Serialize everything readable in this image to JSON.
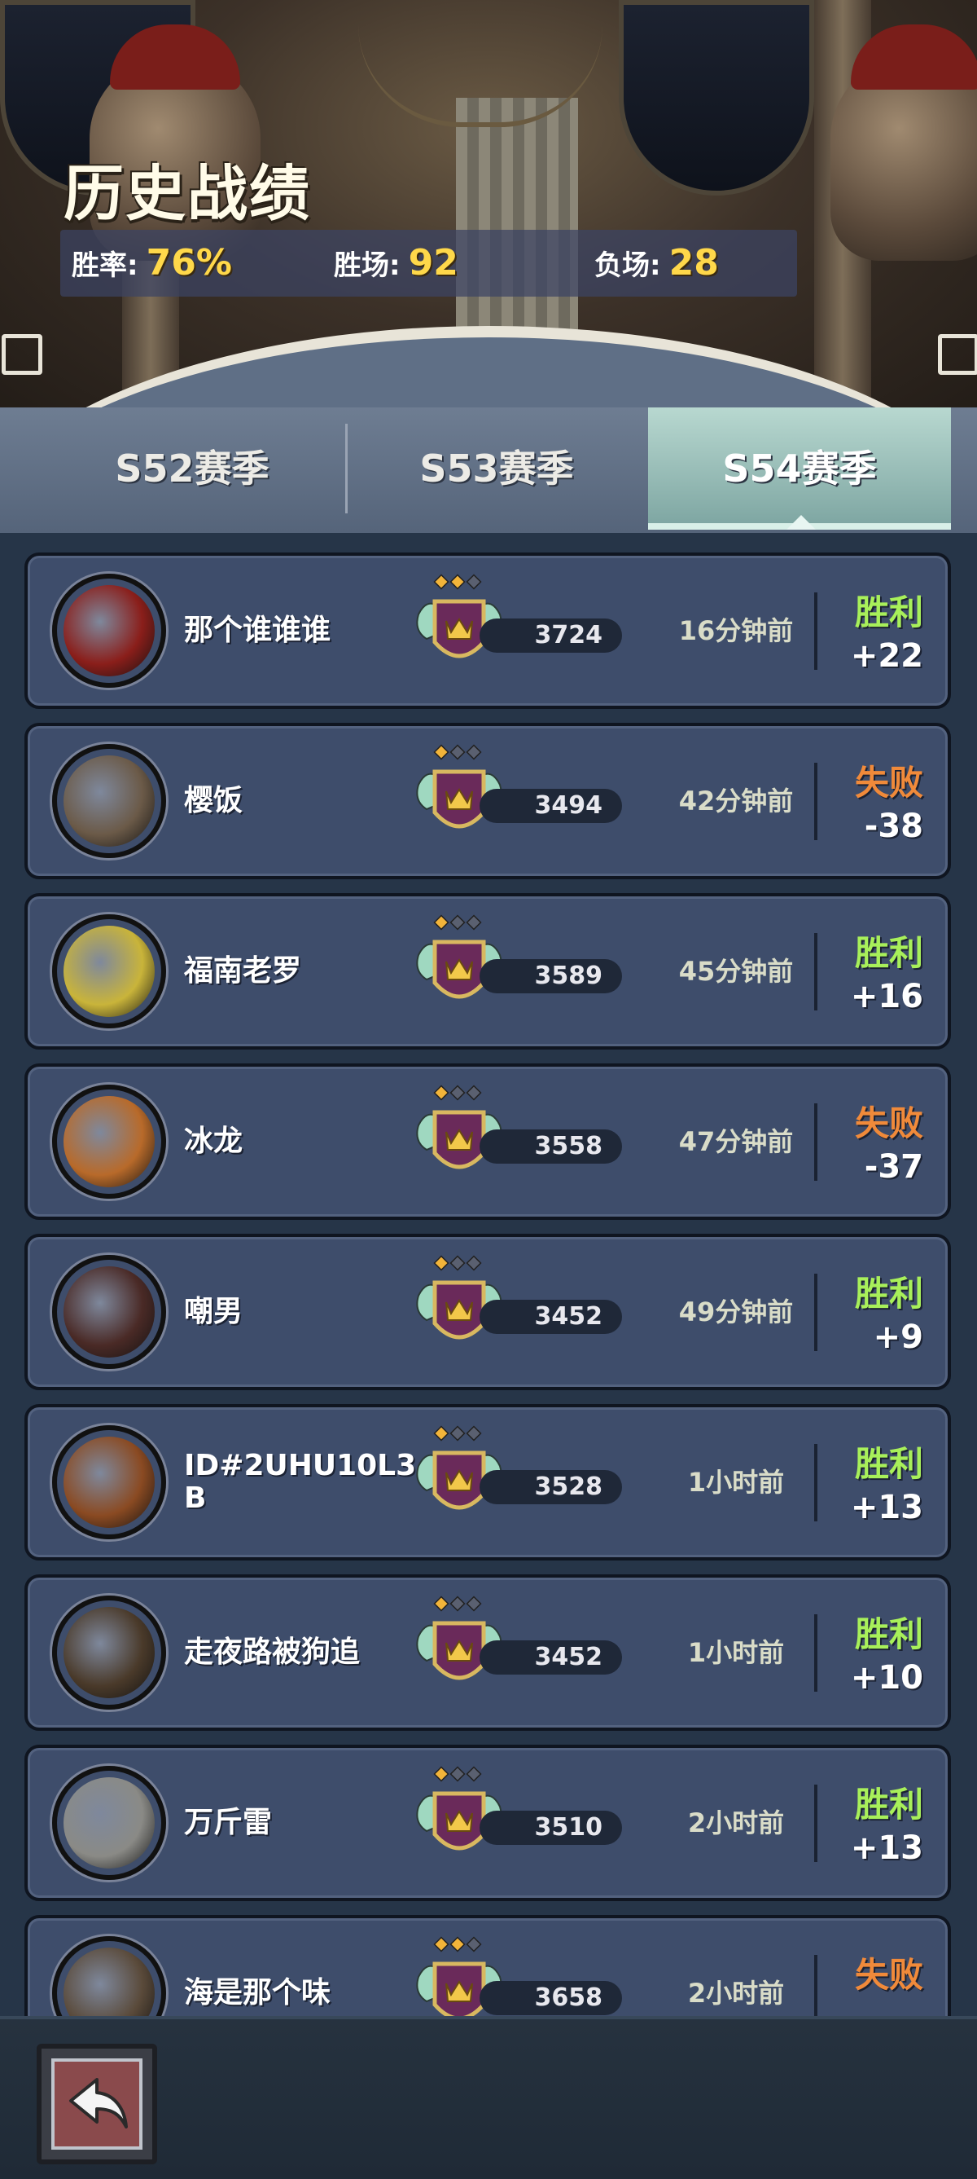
{
  "header": {
    "title": "历史战绩",
    "win_rate_label": "胜率:",
    "win_rate_value": "76%",
    "wins_label": "胜场:",
    "wins_value": "92",
    "losses_label": "负场:",
    "losses_value": "28"
  },
  "tabs": [
    {
      "label": "S52赛季",
      "active": false
    },
    {
      "label": "S53赛季",
      "active": false
    },
    {
      "label": "S54赛季",
      "active": true
    }
  ],
  "matches": [
    {
      "name": "那个谁谁谁",
      "rating": "3724",
      "time": "16分钟前",
      "result": "胜利",
      "delta": "+22",
      "outcome": "win",
      "gems_lit": 2,
      "avatar_color": "#8a1e1a"
    },
    {
      "name": "樱饭",
      "rating": "3494",
      "time": "42分钟前",
      "result": "失败",
      "delta": "-38",
      "outcome": "loss",
      "gems_lit": 1,
      "avatar_color": "#6b5a48"
    },
    {
      "name": "福南老罗",
      "rating": "3589",
      "time": "45分钟前",
      "result": "胜利",
      "delta": "+16",
      "outcome": "win",
      "gems_lit": 1,
      "avatar_color": "#c9b43a"
    },
    {
      "name": "冰龙",
      "rating": "3558",
      "time": "47分钟前",
      "result": "失败",
      "delta": "-37",
      "outcome": "loss",
      "gems_lit": 1,
      "avatar_color": "#b86a2a"
    },
    {
      "name": "嘲男",
      "rating": "3452",
      "time": "49分钟前",
      "result": "胜利",
      "delta": "+9",
      "outcome": "win",
      "gems_lit": 1,
      "avatar_color": "#4a2a26"
    },
    {
      "name": "ID#2UHU10L3B",
      "rating": "3528",
      "time": "1小时前",
      "result": "胜利",
      "delta": "+13",
      "outcome": "win",
      "gems_lit": 1,
      "avatar_color": "#8a4a22"
    },
    {
      "name": "走夜路被狗追",
      "rating": "3452",
      "time": "1小时前",
      "result": "胜利",
      "delta": "+10",
      "outcome": "win",
      "gems_lit": 1,
      "avatar_color": "#4a3a2a"
    },
    {
      "name": "万斤雷",
      "rating": "3510",
      "time": "2小时前",
      "result": "胜利",
      "delta": "+13",
      "outcome": "win",
      "gems_lit": 1,
      "avatar_color": "#8a8a86"
    },
    {
      "name": "海是那个味",
      "rating": "3658",
      "time": "2小时前",
      "result": "失败",
      "delta": "",
      "outcome": "loss",
      "gems_lit": 2,
      "avatar_color": "#5a4a3a"
    }
  ],
  "colors": {
    "win": "#a8f05a",
    "loss": "#f08a3a",
    "stat_value": "#ffd84a"
  },
  "footer": {
    "back_icon": "back-arrow-icon"
  }
}
